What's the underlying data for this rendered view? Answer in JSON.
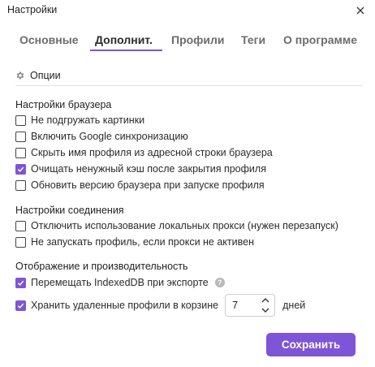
{
  "window": {
    "title": "Настройки"
  },
  "tabs": [
    {
      "label": "Основные"
    },
    {
      "label": "Дополнит."
    },
    {
      "label": "Профили"
    },
    {
      "label": "Теги"
    },
    {
      "label": "О программе"
    }
  ],
  "active_tab": "Дополнит.",
  "section": {
    "title": "Опции",
    "icon": "gear-icon"
  },
  "browser_settings": {
    "title": "Настройки браузера",
    "items": [
      {
        "label": "Не подгружать картинки",
        "checked": false
      },
      {
        "label": "Включить Google синхронизацию",
        "checked": false
      },
      {
        "label": "Скрыть имя профиля из адресной строки браузера",
        "checked": false
      },
      {
        "label": "Очищать ненужный кэш после закрытия профиля",
        "checked": true
      },
      {
        "label": "Обновить версию браузера при запуске профиля",
        "checked": false
      }
    ]
  },
  "connection_settings": {
    "title": "Настройки соединения",
    "items": [
      {
        "label": "Отключить использование локальных прокси (нужен перезапуск)",
        "checked": false
      },
      {
        "label": "Не запускать профиль, если прокси не активен",
        "checked": false
      }
    ]
  },
  "display_performance": {
    "title": "Отображение и производительность",
    "items": [
      {
        "label": "Перемещать IndexedDB при экспорте",
        "checked": true,
        "help": "?"
      },
      {
        "label": "Хранить удаленные профили в корзине",
        "checked": true,
        "value": "7",
        "suffix": "дней"
      }
    ]
  },
  "save_button": {
    "label": "Сохранить"
  },
  "colors": {
    "accent": "#7d55d6",
    "text": "#2b2b2b",
    "muted_tab": "#6c6c6c",
    "divider": "#e3e3e3"
  }
}
